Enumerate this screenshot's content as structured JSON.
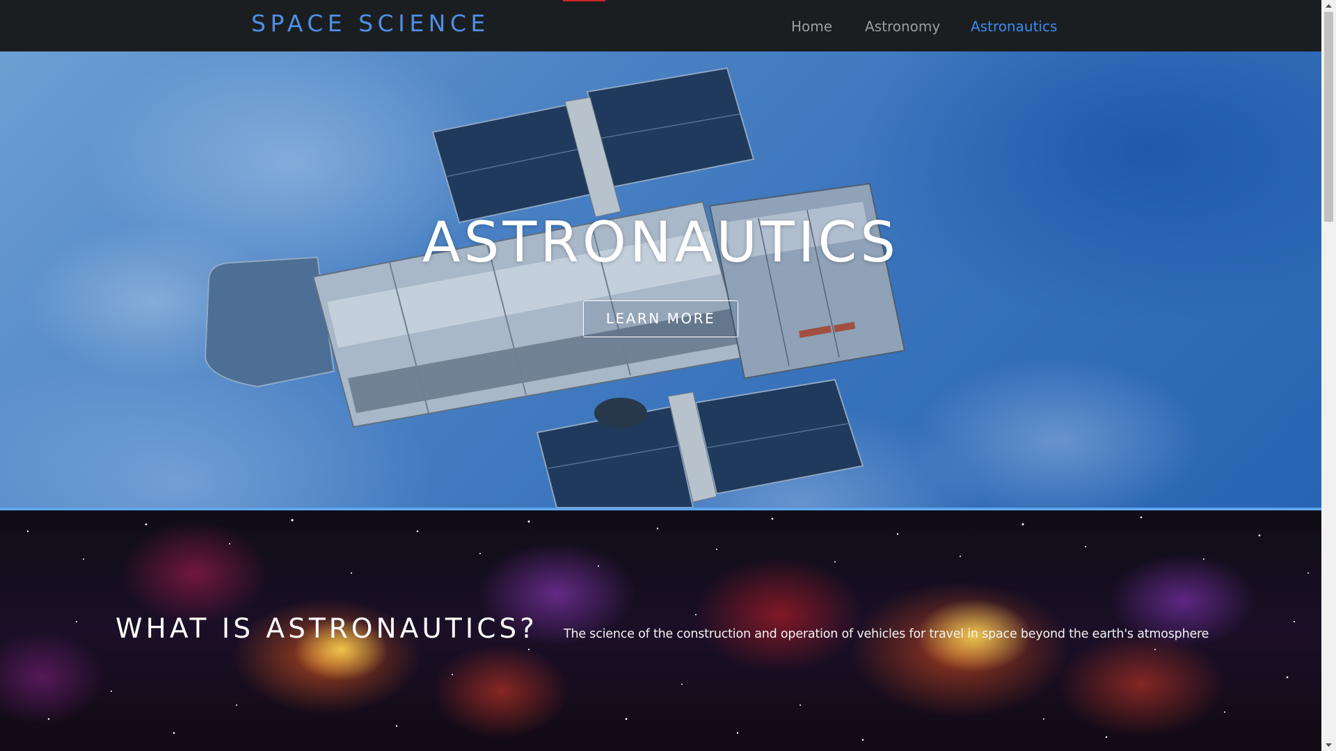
{
  "nav": {
    "brand": "SPACE SCIENCE",
    "links": [
      {
        "label": "Home",
        "active": false
      },
      {
        "label": "Astronomy",
        "active": false
      },
      {
        "label": "Astronautics",
        "active": true
      }
    ]
  },
  "hero": {
    "title": "ASTRONAUTICS",
    "button_label": "LEARN MORE",
    "image": "hubble-space-telescope-over-earth"
  },
  "about": {
    "heading": "WHAT IS ASTRONAUTICS?",
    "text": "The science of the construction and operation of vehicles for travel in space beyond the earth's atmosphere"
  },
  "colors": {
    "nav_bg": "#1b1e21",
    "brand": "#4f8fe6",
    "active_link": "#3a8bef",
    "inactive_link": "#9a9ea3",
    "divider": "#5ea6ec",
    "accent": "#d0242b"
  }
}
